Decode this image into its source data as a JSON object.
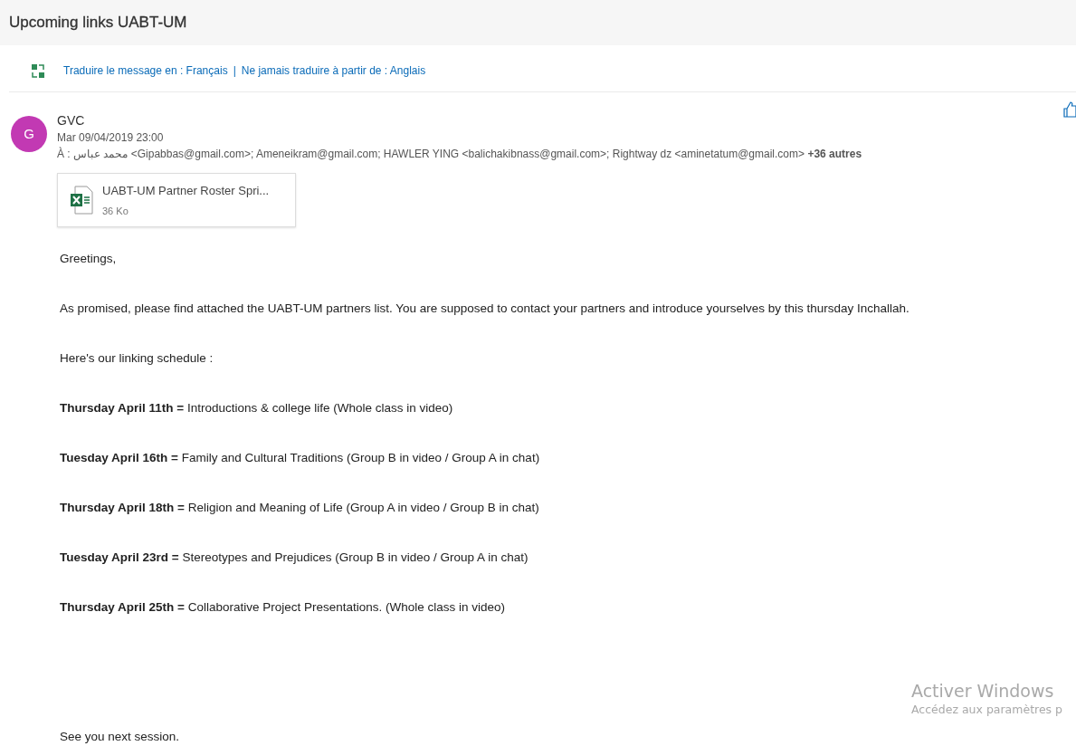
{
  "subject": "Upcoming links UABT-UM",
  "translate": {
    "link_1": "Traduire le message en : Français",
    "separator": "|",
    "link_2": "Ne jamais traduire à partir de : Anglais"
  },
  "message": {
    "avatar_letter": "G",
    "sender": "GVC",
    "date": "Mar 09/04/2019 23:00",
    "recipients": "À : محمد عباس <Gipabbas@gmail.com>; Ameneikram@gmail.com; HAWLER YING <balichakibnass@gmail.com>; Rightway dz <aminetatum@gmail.com> **+36 autres**"
  },
  "attachment": {
    "name": "UABT-UM Partner Roster Spri...",
    "size": "36 Ko"
  },
  "body": [
    {
      "kind": "text",
      "text": "Greetings,"
    },
    {
      "kind": "text",
      "text": "As promised, please find attached the UABT-UM partners list. You are supposed to contact your partners and introduce yourselves by this thursday Inchallah."
    },
    {
      "kind": "text",
      "text": "Here's our linking schedule :"
    },
    {
      "kind": "schedule",
      "date": "Thursday April 11th =",
      "topic": "Introductions & college life (Whole class in video)"
    },
    {
      "kind": "schedule",
      "date": "Tuesday April 16th =",
      "topic": "Family and Cultural Traditions (Group B in video / Group A in chat)"
    },
    {
      "kind": "schedule",
      "date": "Thursday April 18th =",
      "topic": "Religion and Meaning of Life (Group A in video / Group B in chat)"
    },
    {
      "kind": "schedule",
      "date": "Tuesday April 23rd =",
      "topic": "Stereotypes and Prejudices (Group B in video / Group A in chat)"
    },
    {
      "kind": "schedule",
      "date": "Thursday April 25th =",
      "topic": "Collaborative Project Presentations. (Whole class in video)"
    },
    {
      "kind": "spacer"
    },
    {
      "kind": "text",
      "text": "See you next session."
    }
  ],
  "activation": {
    "title": "Activer Windows",
    "subtitle": "Accédez aux paramètres p"
  }
}
